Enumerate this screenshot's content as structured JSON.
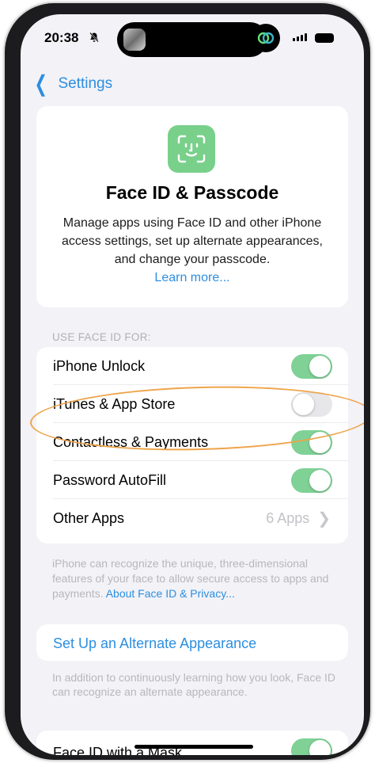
{
  "status_bar": {
    "time": "20:38",
    "bell_icon": "bell-slash-icon"
  },
  "nav": {
    "back_label": "Settings"
  },
  "header": {
    "title": "Face ID & Passcode",
    "description": "Manage apps using Face ID and other iPhone access settings, set up alternate appearances, and change your passcode.",
    "learn_more": "Learn more...",
    "icon": "face-id-icon",
    "icon_color": "#79d08b"
  },
  "section": {
    "label": "USE FACE ID FOR:"
  },
  "rows": [
    {
      "label": "iPhone Unlock",
      "toggle": true
    },
    {
      "label": "iTunes & App Store",
      "toggle": false
    },
    {
      "label": "Contactless & Payments",
      "toggle": true
    },
    {
      "label": "Password AutoFill",
      "toggle": true
    },
    {
      "label": "Other Apps",
      "value": "6 Apps"
    }
  ],
  "footnote": {
    "text": "iPhone can recognize the unique, three-dimensional features of your face to allow secure access to apps and payments. ",
    "link": "About Face ID & Privacy..."
  },
  "alternate": {
    "link": "Set Up an Alternate Appearance"
  },
  "footnote2": {
    "text": "In addition to continuously learning how you look, Face ID can recognize an alternate appearance."
  },
  "mask": {
    "label": "Face ID with a Mask",
    "toggle": true
  },
  "colors": {
    "accent": "#2d8ee0",
    "toggle_on": "#7fd196",
    "highlight": "#eea44a"
  }
}
